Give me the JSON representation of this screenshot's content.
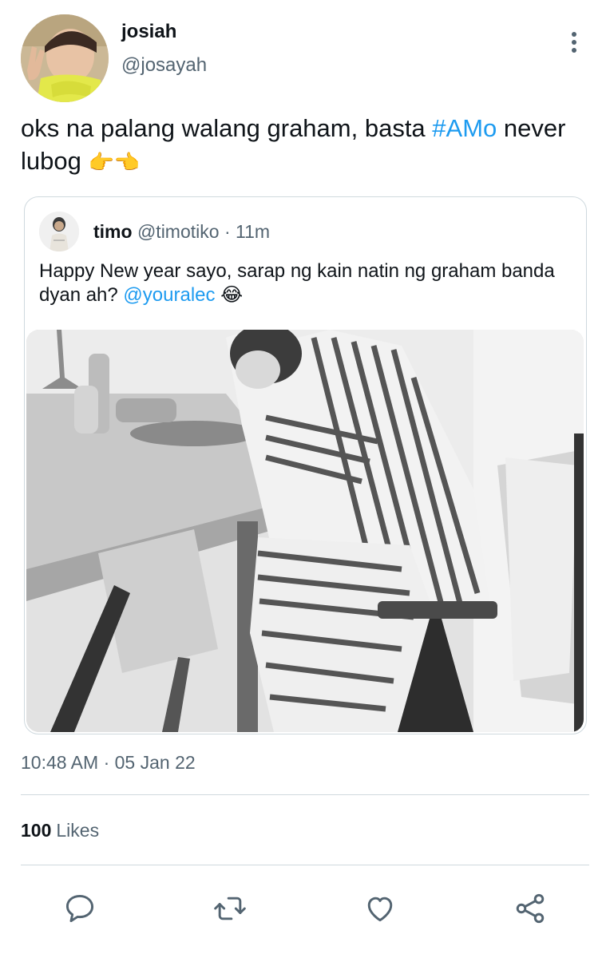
{
  "author": {
    "display_name": "josiah",
    "handle": "@josayah"
  },
  "tweet": {
    "text_before": "oks na palang walang graham, basta ",
    "hashtag": "#AMo",
    "text_after": " never lubog ",
    "emoji": "👉👈"
  },
  "quote": {
    "name": "timo",
    "handle": "@timotiko",
    "time": "11m",
    "text": "Happy New year sayo, sarap ng kain natin ng graham banda dyan ah? ",
    "mention": "@youralec",
    "emoji": "😂"
  },
  "timestamp": "10:48 AM · 05 Jan 22",
  "likes": {
    "count": "100",
    "label": "Likes"
  },
  "actions": {
    "reply_icon": "comment-bubble",
    "retweet_icon": "retweet-arrows",
    "like_icon": "heart",
    "share_icon": "share-nodes"
  },
  "colors": {
    "accent": "#1d9bf0",
    "muted": "#536471",
    "border": "#cfd9de"
  }
}
